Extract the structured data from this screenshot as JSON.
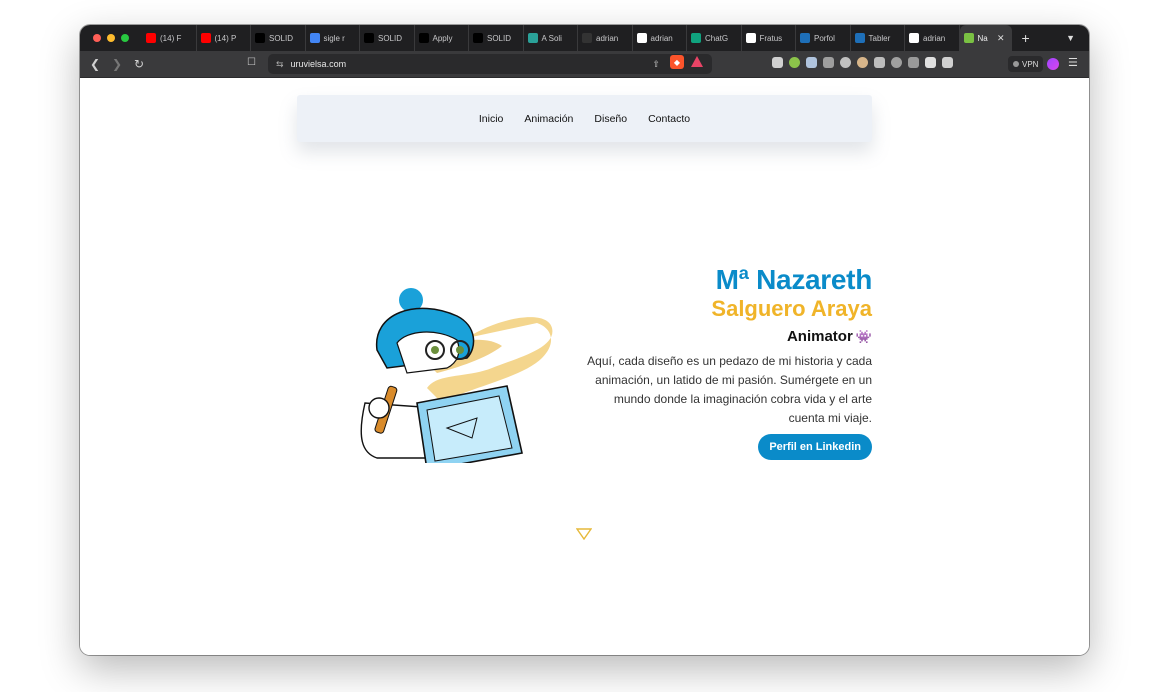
{
  "browser": {
    "tabs": [
      {
        "label": "(14) F",
        "icon": "youtube-icon",
        "color": "#ff0000"
      },
      {
        "label": "(14) P",
        "icon": "youtube-icon",
        "color": "#ff0000"
      },
      {
        "label": "SOLID",
        "icon": "medium-icon",
        "color": "#000000"
      },
      {
        "label": "sigle r",
        "icon": "google-icon",
        "color": "#4285f4"
      },
      {
        "label": "SOLID",
        "icon": "medium-icon",
        "color": "#000000"
      },
      {
        "label": "Apply",
        "icon": "medium-icon",
        "color": "#000000"
      },
      {
        "label": "SOLID",
        "icon": "medium-icon",
        "color": "#000000"
      },
      {
        "label": "A Soli",
        "icon": "globe-icon",
        "color": "#2aa198"
      },
      {
        "label": "adrian",
        "icon": "github-icon",
        "color": "#333333"
      },
      {
        "label": "adrian",
        "icon": "github-icon",
        "color": "#ffffff"
      },
      {
        "label": "ChatG",
        "icon": "chatgpt-icon",
        "color": "#10a37f"
      },
      {
        "label": "Fratus",
        "icon": "github-icon",
        "color": "#ffffff"
      },
      {
        "label": "Porfol",
        "icon": "vscode-icon",
        "color": "#1e6fb8"
      },
      {
        "label": "Tabler",
        "icon": "terminal-icon",
        "color": "#1e6fb8"
      },
      {
        "label": "adrian",
        "icon": "github-icon",
        "color": "#ffffff"
      },
      {
        "label": "Na",
        "icon": "site-favicon-icon",
        "color": "#7ac143",
        "active": true
      }
    ],
    "url": "uruvielsa.com",
    "vpn_label": "VPN"
  },
  "site": {
    "nav": [
      "Inicio",
      "Animación",
      "Diseño",
      "Contacto"
    ],
    "hero": {
      "name_line1": "Mª Nazareth",
      "name_line2": "Salguero Araya",
      "role": "Animator",
      "role_emoji": "👾",
      "bio": "Aquí, cada diseño es un pedazo de mi historia y cada animación, un latido de mi pasión. Sumérgete en un mundo donde la imaginación cobra vida y el arte cuenta mi viaje.",
      "cta": "Perfil en Linkedin"
    },
    "colors": {
      "primary_blue": "#0a8bc9",
      "accent_yellow": "#f0b429",
      "nav_bg": "#edf1f7"
    }
  }
}
